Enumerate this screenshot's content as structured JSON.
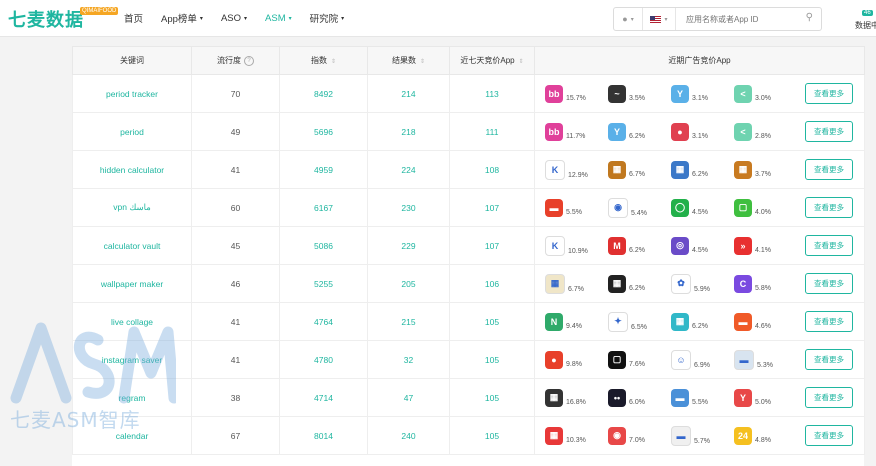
{
  "header": {
    "logo_text": "七麦数据",
    "logo_badge": "QIMAIFOOD",
    "nav": [
      {
        "label": "首页",
        "caret": false,
        "active": false
      },
      {
        "label": "App榜单",
        "caret": true,
        "active": false
      },
      {
        "label": "ASO",
        "caret": true,
        "active": false
      },
      {
        "label": "ASM",
        "caret": true,
        "active": true
      },
      {
        "label": "研究院",
        "caret": true,
        "active": false
      }
    ],
    "search_placeholder": "应用名称或者App ID",
    "right_tag": "46",
    "right_text": "数据中"
  },
  "table": {
    "headers": [
      "关键词",
      "流行度",
      "指数",
      "结果数",
      "近七天竞价App",
      "近期广告竞价App"
    ],
    "more_label": "查看更多",
    "rows": [
      {
        "keyword": "period tracker",
        "popularity": "70",
        "index": "8492",
        "results": "214",
        "bid_apps": "113",
        "apps": [
          {
            "share": "15.7%",
            "color": "#e0409a",
            "glyph": "bb"
          },
          {
            "share": "3.5%",
            "color": "#333333",
            "glyph": "~"
          },
          {
            "share": "3.1%",
            "color": "#5ab0e8",
            "glyph": "Y"
          },
          {
            "share": "3.0%",
            "color": "#6fd3b0",
            "glyph": "<"
          }
        ]
      },
      {
        "keyword": "period",
        "popularity": "49",
        "index": "5696",
        "results": "218",
        "bid_apps": "111",
        "apps": [
          {
            "share": "11.7%",
            "color": "#e0409a",
            "glyph": "bb"
          },
          {
            "share": "6.2%",
            "color": "#5ab0e8",
            "glyph": "Y"
          },
          {
            "share": "3.1%",
            "color": "#e04050",
            "glyph": "●"
          },
          {
            "share": "2.8%",
            "color": "#6fd3b0",
            "glyph": "<"
          }
        ]
      },
      {
        "keyword": "hidden calculator",
        "popularity": "41",
        "index": "4959",
        "results": "224",
        "bid_apps": "108",
        "apps": [
          {
            "share": "12.9%",
            "color": "#ffffff",
            "glyph": "K"
          },
          {
            "share": "6.7%",
            "color": "#c0781f",
            "glyph": "▦"
          },
          {
            "share": "6.2%",
            "color": "#3b78c8",
            "glyph": "▦"
          },
          {
            "share": "3.7%",
            "color": "#c87a20",
            "glyph": "▦"
          }
        ]
      },
      {
        "keyword": "vpn ماسك",
        "popularity": "60",
        "index": "6167",
        "results": "230",
        "bid_apps": "107",
        "apps": [
          {
            "share": "5.5%",
            "color": "#e8402a",
            "glyph": "▬"
          },
          {
            "share": "5.4%",
            "color": "#ffffff",
            "glyph": "◉"
          },
          {
            "share": "4.5%",
            "color": "#22b04a",
            "glyph": "◯"
          },
          {
            "share": "4.0%",
            "color": "#3fbf3f",
            "glyph": "▢"
          }
        ]
      },
      {
        "keyword": "calculator vault",
        "popularity": "45",
        "index": "5086",
        "results": "229",
        "bid_apps": "107",
        "apps": [
          {
            "share": "10.9%",
            "color": "#ffffff",
            "glyph": "K"
          },
          {
            "share": "6.2%",
            "color": "#e03030",
            "glyph": "M"
          },
          {
            "share": "4.5%",
            "color": "#6a4bc8",
            "glyph": "◎"
          },
          {
            "share": "4.1%",
            "color": "#e83030",
            "glyph": "»"
          }
        ]
      },
      {
        "keyword": "wallpaper maker",
        "popularity": "46",
        "index": "5255",
        "results": "205",
        "bid_apps": "106",
        "apps": [
          {
            "share": "6.7%",
            "color": "#f0e6c8",
            "glyph": "▦"
          },
          {
            "share": "6.2%",
            "color": "#222222",
            "glyph": "▦"
          },
          {
            "share": "5.9%",
            "color": "#ffffff",
            "glyph": "✿"
          },
          {
            "share": "5.8%",
            "color": "#7a4ae0",
            "glyph": "C"
          }
        ]
      },
      {
        "keyword": "live collage",
        "popularity": "41",
        "index": "4764",
        "results": "215",
        "bid_apps": "105",
        "apps": [
          {
            "share": "9.4%",
            "color": "#2faa6a",
            "glyph": "N"
          },
          {
            "share": "6.5%",
            "color": "#ffffff",
            "glyph": "✦"
          },
          {
            "share": "6.2%",
            "color": "#30b8c8",
            "glyph": "▦"
          },
          {
            "share": "4.6%",
            "color": "#f05a28",
            "glyph": "▬"
          }
        ]
      },
      {
        "keyword": "instagram saver",
        "popularity": "41",
        "index": "4780",
        "results": "32",
        "bid_apps": "105",
        "apps": [
          {
            "share": "9.8%",
            "color": "#e8402a",
            "glyph": "●"
          },
          {
            "share": "7.6%",
            "color": "#111111",
            "glyph": "▢"
          },
          {
            "share": "6.9%",
            "color": "#ffffff",
            "glyph": "☺"
          },
          {
            "share": "5.3%",
            "color": "#d8e4f0",
            "glyph": "▬"
          }
        ]
      },
      {
        "keyword": "regram",
        "popularity": "38",
        "index": "4714",
        "results": "47",
        "bid_apps": "105",
        "apps": [
          {
            "share": "16.8%",
            "color": "#333333",
            "glyph": "▦"
          },
          {
            "share": "6.0%",
            "color": "#1a1a2a",
            "glyph": "••"
          },
          {
            "share": "5.5%",
            "color": "#4a90d8",
            "glyph": "▬"
          },
          {
            "share": "5.0%",
            "color": "#e84848",
            "glyph": "Y"
          }
        ]
      },
      {
        "keyword": "calendar",
        "popularity": "67",
        "index": "8014",
        "results": "240",
        "bid_apps": "105",
        "apps": [
          {
            "share": "10.3%",
            "color": "#e83838",
            "glyph": "▦"
          },
          {
            "share": "7.0%",
            "color": "#e84848",
            "glyph": "◉"
          },
          {
            "share": "5.7%",
            "color": "#f0f0f0",
            "glyph": "▬"
          },
          {
            "share": "4.8%",
            "color": "#f5c020",
            "glyph": "24"
          }
        ]
      }
    ]
  },
  "watermark": {
    "text": "七麦ASM智库"
  }
}
